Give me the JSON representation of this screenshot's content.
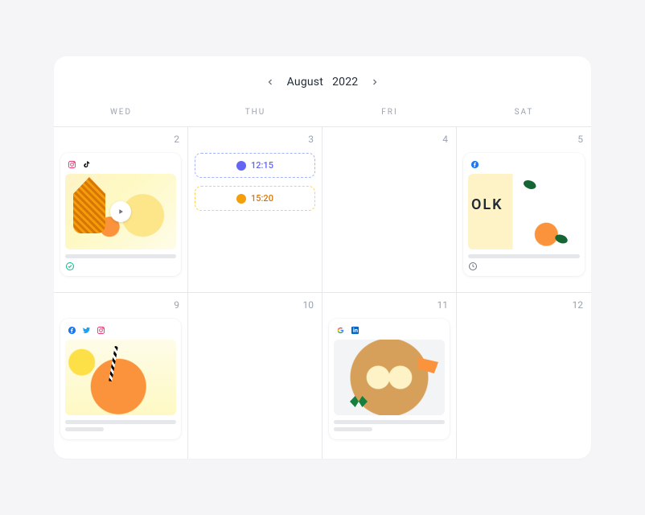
{
  "header": {
    "month_label": "August",
    "year_label": "2022"
  },
  "weekdays": [
    "WED",
    "THU",
    "FRI",
    "SAT"
  ],
  "days": {
    "wed1": "2",
    "thu1": "3",
    "fri1": "4",
    "sat1": "5",
    "wed2": "9",
    "thu2": "10",
    "fri2": "11",
    "sat2": "12"
  },
  "slots": {
    "thu1": {
      "time": "12:15",
      "variant": "purple"
    },
    "thu2": {
      "time": "15:20",
      "variant": "yellow"
    }
  },
  "folk_thumb_text": "OLK",
  "icons": {
    "instagram": "instagram-icon",
    "tiktok": "tiktok-icon",
    "facebook": "facebook-icon",
    "twitter": "twitter-icon",
    "google": "google-icon",
    "linkedin": "linkedin-icon",
    "clock": "clock-icon",
    "check": "check-circle-icon",
    "play": "play-icon"
  },
  "colors": {
    "instagram": "#e1306c",
    "tiktok": "#000000",
    "facebook": "#1877f2",
    "twitter": "#1da1f2",
    "google": "#ea4335",
    "linkedin": "#0a66c2",
    "check": "#10b981",
    "slot_purple": "#6366f1",
    "slot_yellow": "#f59e0b"
  }
}
